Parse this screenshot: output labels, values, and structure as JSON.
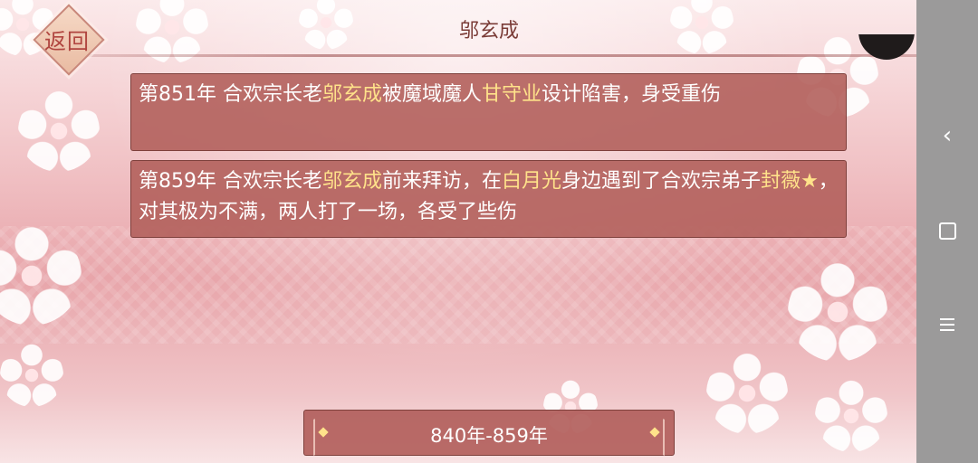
{
  "header": {
    "back_label": "返回",
    "title": "邬玄成"
  },
  "events": [
    {
      "parts": [
        {
          "text": "第851年 合欢宗长老",
          "hl": false
        },
        {
          "text": "邬玄成",
          "hl": true
        },
        {
          "text": "被魔域魔人",
          "hl": false
        },
        {
          "text": "甘守业",
          "hl": true
        },
        {
          "text": "设计陷害，身受重伤",
          "hl": false
        }
      ]
    },
    {
      "parts": [
        {
          "text": "第859年 合欢宗长老",
          "hl": false
        },
        {
          "text": "邬玄成",
          "hl": true
        },
        {
          "text": "前来拜访，在",
          "hl": false
        },
        {
          "text": "白月光",
          "hl": true
        },
        {
          "text": "身边遇到了合欢宗弟子",
          "hl": false
        },
        {
          "text": "封薇★",
          "hl": true
        },
        {
          "text": "，对其极为不满，两人打了一场，各受了些伤",
          "hl": false
        }
      ]
    }
  ],
  "footer": {
    "range_label": "840年-859年"
  },
  "colors": {
    "highlight": "#ffe28a",
    "box_fill": "#b2605c",
    "nav_bar": "#9b9a9a"
  },
  "icons": {
    "nav_back": "chevron-left-icon",
    "nav_home": "square-icon",
    "nav_menu": "menu-icon"
  }
}
